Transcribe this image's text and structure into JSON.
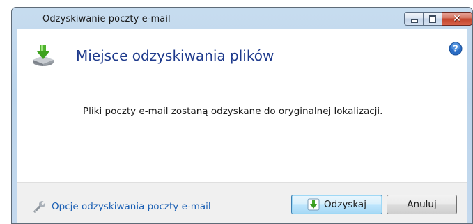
{
  "window": {
    "title": "Odzyskiwanie poczty e-mail",
    "close_glyph": "✕"
  },
  "content": {
    "heading": "Miejsce odzyskiwania plików",
    "message": "Pliki poczty e-mail zostaną odzyskane do oryginalnej lokalizacji."
  },
  "footer": {
    "options_link": "Opcje odzyskiwania poczty e-mail",
    "recover_button": "Odzyskaj",
    "cancel_button": "Anuluj"
  },
  "icons": {
    "header": "drive-download-icon",
    "help": "help-icon",
    "options": "wrench-icon",
    "recover": "green-down-arrow-icon"
  },
  "colors": {
    "heading": "#1e3a8c",
    "link": "#1a5fb4",
    "titlebar": "#bcd5ec",
    "close_button": "#c2432a"
  }
}
